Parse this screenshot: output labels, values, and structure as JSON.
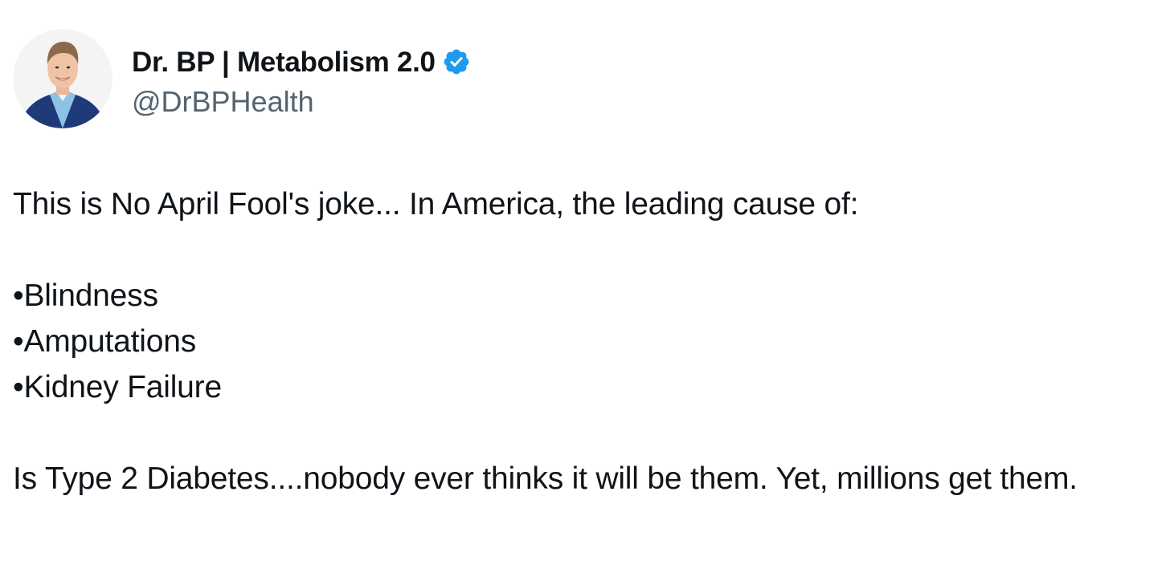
{
  "author": {
    "display_name": "Dr. BP | Metabolism 2.0",
    "handle": "@DrBPHealth",
    "verified": true,
    "verified_icon": "verified-badge-icon",
    "verified_color": "#1d9bf0",
    "avatar": "avatar-photo"
  },
  "tweet": {
    "intro": "This is No April Fool's joke... In America, the leading cause of:",
    "bullets": [
      "•Blindness",
      "•Amputations",
      "•Kidney Failure"
    ],
    "conclusion": "Is Type 2 Diabetes....nobody ever thinks it will be them. Yet, millions get them."
  },
  "colors": {
    "text": "#0f1419",
    "secondary_text": "#536471",
    "background": "#ffffff",
    "accent": "#1d9bf0"
  }
}
